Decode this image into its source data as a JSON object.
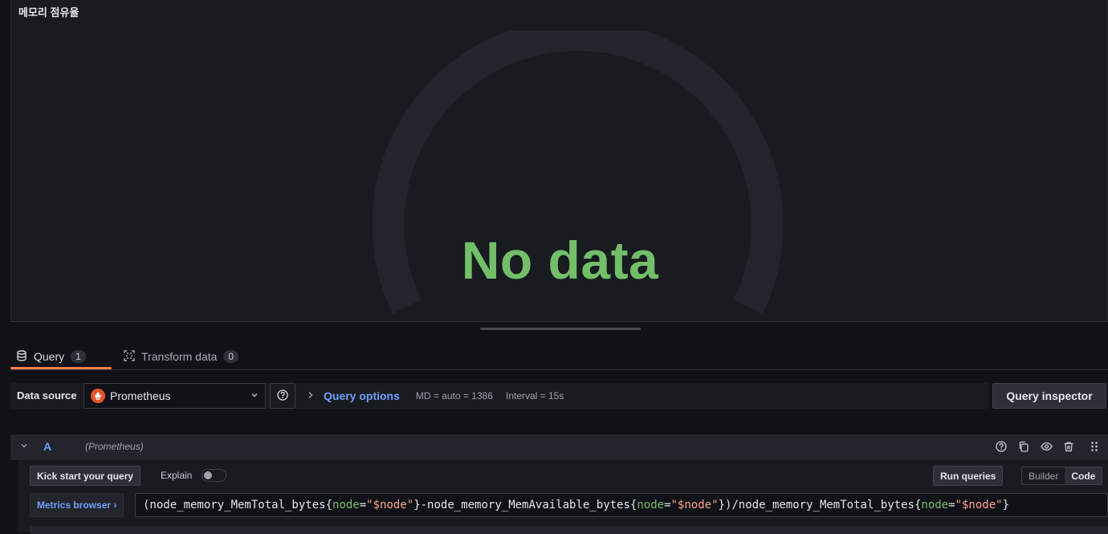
{
  "panel": {
    "title": "메모리 점유율",
    "empty_text": "No data",
    "empty_text_color": "#73bf69"
  },
  "tabs": [
    {
      "label": "Query",
      "count": "1",
      "active": true
    },
    {
      "label": "Transform data",
      "count": "0",
      "active": false
    }
  ],
  "datasource": {
    "label": "Data source",
    "selected": "Prometheus",
    "icon": "prometheus-logo",
    "help_icon": "question-circle-icon",
    "query_options": {
      "label": "Query options",
      "md": "MD = auto = 1386",
      "interval": "Interval = 15s"
    },
    "inspector_label": "Query inspector"
  },
  "query": {
    "ref_id": "A",
    "datasource_hint": "(Prometheus)",
    "actions": [
      "help-icon",
      "duplicate-icon",
      "eye-icon",
      "trash-icon",
      "drag-handle-icon"
    ],
    "kick_start_label": "Kick start your query",
    "explain_label": "Explain",
    "explain_enabled": false,
    "run_label": "Run queries",
    "modes": [
      "Builder",
      "Code"
    ],
    "active_mode": "Code",
    "metrics_browser_label": "Metrics browser ›",
    "expression_tokens": [
      {
        "t": "(node_memory_MemTotal_bytes{",
        "k": "p"
      },
      {
        "t": "node",
        "k": "l"
      },
      {
        "t": "=",
        "k": "p"
      },
      {
        "t": "\"$node\"",
        "k": "s"
      },
      {
        "t": "}-node_memory_MemAvailable_bytes{",
        "k": "p"
      },
      {
        "t": "node",
        "k": "l"
      },
      {
        "t": "=",
        "k": "p"
      },
      {
        "t": "\"$node\"",
        "k": "s"
      },
      {
        "t": "})/node_memory_MemTotal_bytes{",
        "k": "p"
      },
      {
        "t": "node",
        "k": "l"
      },
      {
        "t": "=",
        "k": "p"
      },
      {
        "t": "\"$node\"",
        "k": "s"
      },
      {
        "t": "}",
        "k": "p"
      }
    ]
  },
  "colors": {
    "accent": "#ff7f47",
    "link": "#6e9fff"
  }
}
